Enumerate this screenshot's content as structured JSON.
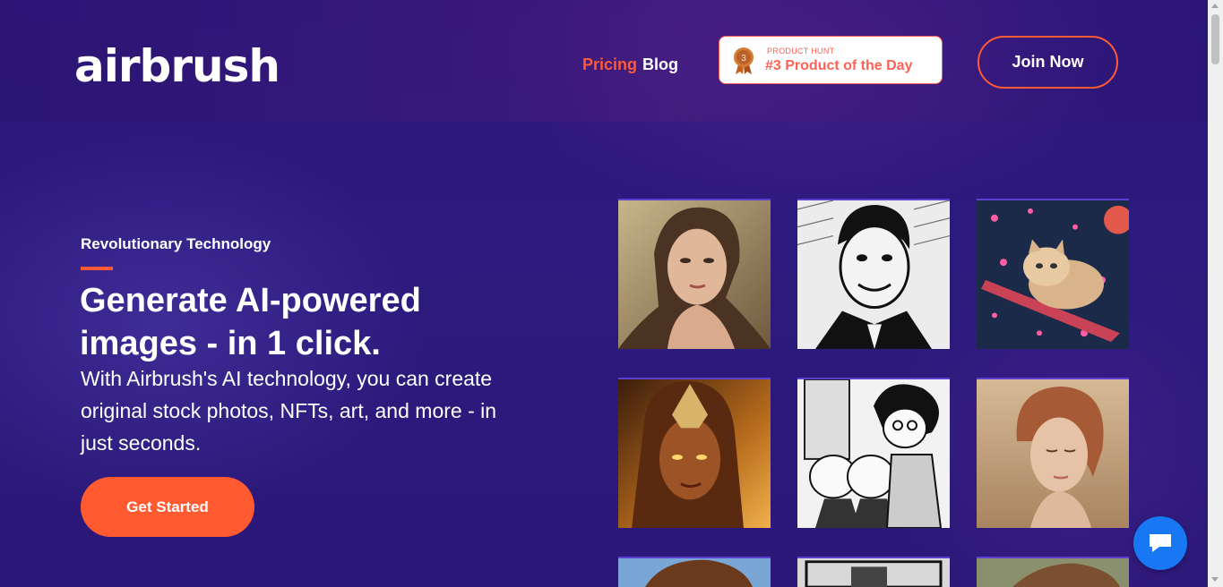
{
  "header": {
    "logo": "airbrush",
    "nav": {
      "pricing": "Pricing",
      "blog": "Blog"
    },
    "product_hunt": {
      "small": "PRODUCT HUNT",
      "big": "#3 Product of the Day",
      "rank": "3"
    },
    "join": "Join Now"
  },
  "hero": {
    "eyebrow": "Revolutionary Technology",
    "headline": "Generate AI-powered images - in 1 click.",
    "subtext": "With Airbrush's AI technology, you can create original stock photos, NFTs, art, and more - in just seconds.",
    "cta": "Get Started"
  },
  "gallery": [
    {
      "name": "portrait-woman-thumb"
    },
    {
      "name": "ink-man-thumb"
    },
    {
      "name": "space-cat-thumb"
    },
    {
      "name": "warrior-woman-thumb"
    },
    {
      "name": "manga-kids-thumb"
    },
    {
      "name": "soft-portrait-thumb"
    }
  ],
  "colors": {
    "accent": "#ff5a36",
    "background": "#2a1777",
    "chat": "#1877f2"
  },
  "icons": {
    "chat": "chat-bubble-icon",
    "medal": "medal-icon"
  }
}
